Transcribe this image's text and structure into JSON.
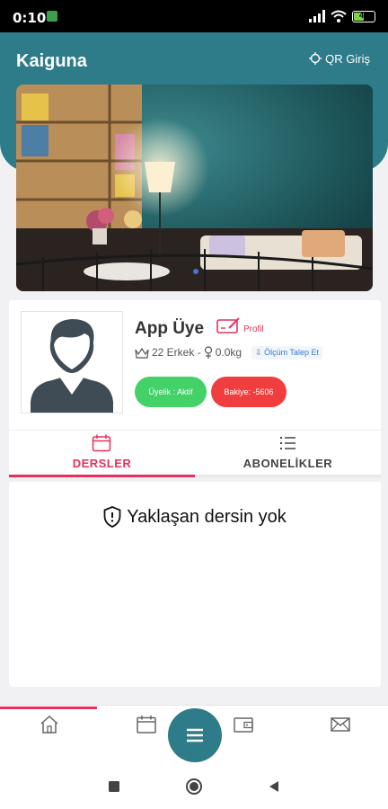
{
  "status": {
    "time": "0:10",
    "battery": "46"
  },
  "header": {
    "title": "Kaiguna",
    "qr_label": "QR Giriş"
  },
  "banner": {
    "active_slide": 1
  },
  "profile": {
    "name": "App Üye",
    "edit_label": "Profil",
    "age_gender": "22 Erkek -",
    "weight": "0.0kg",
    "measure_request": "Ölçüm Talep Et",
    "membership_badge": "Üyelik : Aktif",
    "balance_badge": "Bakiye: -5606"
  },
  "tabs": [
    {
      "label": "DERSLER",
      "active": true
    },
    {
      "label": "ABONELİKLER",
      "active": false
    }
  ],
  "content": {
    "empty_message": "Yaklaşan dersin yok"
  },
  "bottom_nav": [
    "home-icon",
    "calendar-icon",
    "menu-icon",
    "wallet-icon",
    "mail-icon"
  ],
  "colors": {
    "primary": "#2e7b8a",
    "accent": "#e5315b",
    "active_badge": "#43d168",
    "balance_badge": "#f03e3e"
  }
}
